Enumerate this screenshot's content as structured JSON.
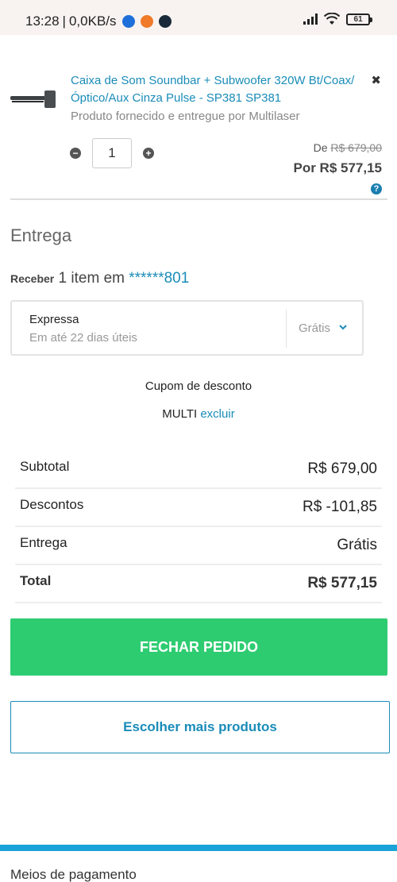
{
  "status_bar": {
    "time": "13:28",
    "network_speed": "0,0KB/s",
    "battery": "61",
    "app_icons": [
      "messages-icon",
      "orange-app-icon",
      "game-icon"
    ]
  },
  "product": {
    "title": "Caixa de Som Soundbar + Subwoofer 320W Bt/Coax/ Óptico/Aux Cinza Pulse - SP381 SP381",
    "supplier": "Produto fornecido e entregue por Multilaser",
    "quantity": "1",
    "price_from_label": "De",
    "price_from": "R$ 679,00",
    "price_now": "Por R$ 577,15",
    "help": "?"
  },
  "delivery": {
    "section_title": "Entrega",
    "receive_label": "Receber",
    "receive_text": " 1 item em ",
    "cep": "******801",
    "option_name": "Expressa",
    "option_time": "Em até 22 dias úteis",
    "option_price": "Grátis"
  },
  "coupon": {
    "title": "Cupom de desconto",
    "code": "MULTI",
    "remove_label": "excluir"
  },
  "summary": {
    "subtotal_label": "Subtotal",
    "subtotal_value": "R$ 679,00",
    "discount_label": "Descontos",
    "discount_value": "R$ -101,85",
    "shipping_label": "Entrega",
    "shipping_value": "Grátis",
    "total_label": "Total",
    "total_value": "R$ 577,15"
  },
  "actions": {
    "checkout_label": "FECHAR PEDIDO",
    "more_label": "Escolher mais produtos"
  },
  "payment": {
    "title": "Meios de pagamento"
  },
  "colors": {
    "link": "#1a8cb8",
    "checkout": "#2ecc71",
    "bar": "#1aa3d8"
  }
}
